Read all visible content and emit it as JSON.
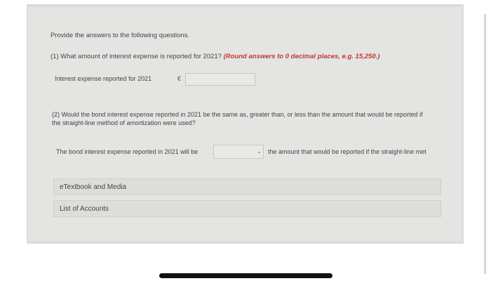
{
  "intro": "Provide the answers to the following questions.",
  "q1": {
    "text": "(1) What amount of interest expense is reported for 2021?",
    "hint": "(Round answers to 0 decimal places, e.g. 15,250.)",
    "row_label": "Interest expense reported for 2021",
    "currency": "€",
    "value": ""
  },
  "q2": {
    "text": "(2) Would the bond interest expense reported in 2021 be the same as, greater than, or less than the amount that would be reported if the straight-line method of amortization were used?",
    "row_label": "The bond interest expense reported in 2021 will be",
    "selected": "",
    "after_text": "the amount that would be reported if the straight-line met"
  },
  "links": {
    "etextbook": "eTextbook and Media",
    "accounts": "List of Accounts"
  }
}
